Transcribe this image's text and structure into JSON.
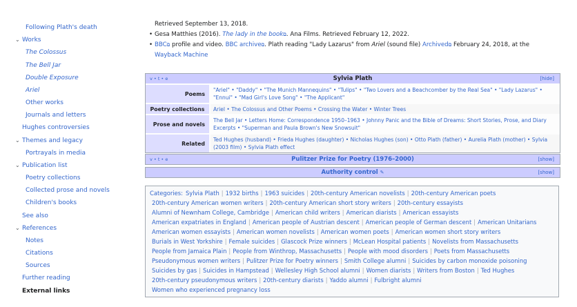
{
  "toc": {
    "items": [
      {
        "label": "Following Plath's death",
        "italic": false,
        "chevron": false
      },
      {
        "label": "Works",
        "italic": false,
        "chevron": true
      },
      {
        "label": "The Colossus",
        "italic": true,
        "chevron": false
      },
      {
        "label": "The Bell Jar",
        "italic": true,
        "chevron": false
      },
      {
        "label": "Double Exposure",
        "italic": true,
        "chevron": false
      },
      {
        "label": "Ariel",
        "italic": true,
        "chevron": false
      },
      {
        "label": "Other works",
        "italic": false,
        "chevron": false
      },
      {
        "label": "Journals and letters",
        "italic": false,
        "chevron": false
      },
      {
        "label": "Hughes controversies",
        "italic": false,
        "chevron": false
      },
      {
        "label": "Themes and legacy",
        "italic": false,
        "chevron": true
      },
      {
        "label": "Portrayals in media",
        "italic": false,
        "chevron": false
      },
      {
        "label": "Publication list",
        "italic": false,
        "chevron": true
      },
      {
        "label": "Poetry collections",
        "italic": false,
        "chevron": false
      },
      {
        "label": "Collected prose and novels",
        "italic": false,
        "chevron": false
      },
      {
        "label": "Children's books",
        "italic": false,
        "chevron": false
      },
      {
        "label": "See also",
        "italic": false,
        "chevron": false
      },
      {
        "label": "References",
        "italic": false,
        "chevron": true
      },
      {
        "label": "Notes",
        "italic": false,
        "chevron": false
      },
      {
        "label": "Citations",
        "italic": false,
        "chevron": false
      },
      {
        "label": "Sources",
        "italic": false,
        "chevron": false
      },
      {
        "label": "Further reading",
        "italic": false,
        "chevron": false
      },
      {
        "label": "External links",
        "italic": false,
        "chevron": false,
        "bold": true
      }
    ]
  },
  "refs": {
    "line1": "Retrieved September 13, 2018.",
    "line2_a": "Gesa Matthies (2016).",
    "line2_link": "The lady in the book",
    "line2_b": ". Ana Films. Retrieved February 12, 2022.",
    "line3_bbc": "BBC",
    "line3_a": " profile and video.",
    "line3_archive": "BBC archive",
    "line3_b": ". Plath reading \"Lady Lazarus\" from",
    "line3_ariel": "Ariel",
    "line3_c": "(sound file)",
    "line3_archived": "Archived",
    "line3_d": "February 24, 2018, at the",
    "line4": "Wayback Machine"
  },
  "navbox": {
    "vte": "v • t • e",
    "title": "Sylvia Plath",
    "hide": "[hide]",
    "rows": [
      {
        "group": "Poems",
        "text": "\"Ariel\" • \"Daddy\" • \"The Munich Mannequins\" • \"Tulips\" • \"Two Lovers and a Beachcomber by the Real Sea\" • \"Lady Lazarus\" • \"Ennui\" • \"Mad Girl's Love Song\" • \"The Applicant\""
      },
      {
        "group": "Poetry collections",
        "text": "Ariel • The Colossus and Other Poems • Crossing the Water • Winter Trees"
      },
      {
        "group": "Prose and novels",
        "text": "The Bell Jar • Letters Home: Correspondence 1950–1963 • Johnny Panic and the Bible of Dreams: Short Stories, Prose, and Diary Excerpts • \"Superman and Paula Brown's New Snowsuit\""
      },
      {
        "group": "Related",
        "text": "Ted Hughes (husband) • Frieda Hughes (daughter) • Nicholas Hughes (son) • Otto Plath (father) • Aurelia Plath (mother) • Sylvia (2003 film) • Sylvia Plath effect"
      }
    ]
  },
  "pulitzer": {
    "vte": "v • t • e",
    "title": "Pulitzer Prize for Poetry (1976–2000)",
    "show": "[show]"
  },
  "authority": {
    "title": "Authority control",
    "show": "[show]"
  },
  "categories": {
    "label": "Categories:",
    "lines": [
      [
        "Sylvia Plath",
        "1932 births",
        "1963 suicides",
        "20th-century American novelists",
        "20th-century American poets"
      ],
      [
        "20th-century American women writers",
        "20th-century American short story writers",
        "20th-century essayists"
      ],
      [
        "Alumni of Newnham College, Cambridge",
        "American child writers",
        "American diarists",
        "American essayists"
      ],
      [
        "American expatriates in England",
        "American people of Austrian descent",
        "American people of German descent",
        "American Unitarians"
      ],
      [
        "American women essayists",
        "American women novelists",
        "American women poets",
        "American women short story writers"
      ],
      [
        "Burials in West Yorkshire",
        "Female suicides",
        "Glascock Prize winners",
        "McLean Hospital patients",
        "Novelists from Massachusetts"
      ],
      [
        "People from Jamaica Plain",
        "People from Winthrop, Massachusetts",
        "People with mood disorders",
        "Poets from Massachusetts"
      ],
      [
        "Pseudonymous women writers",
        "Pulitzer Prize for Poetry winners",
        "Smith College alumni",
        "Suicides by carbon monoxide poisoning"
      ],
      [
        "Suicides by gas",
        "Suicides in Hampstead",
        "Wellesley High School alumni",
        "Women diarists",
        "Writers from Boston",
        "Ted Hughes"
      ],
      [
        "20th-century pseudonymous writers",
        "20th-century diarists",
        "Yaddo alumni",
        "Fulbright alumni"
      ],
      [
        "Women who experienced pregnancy loss"
      ]
    ]
  }
}
